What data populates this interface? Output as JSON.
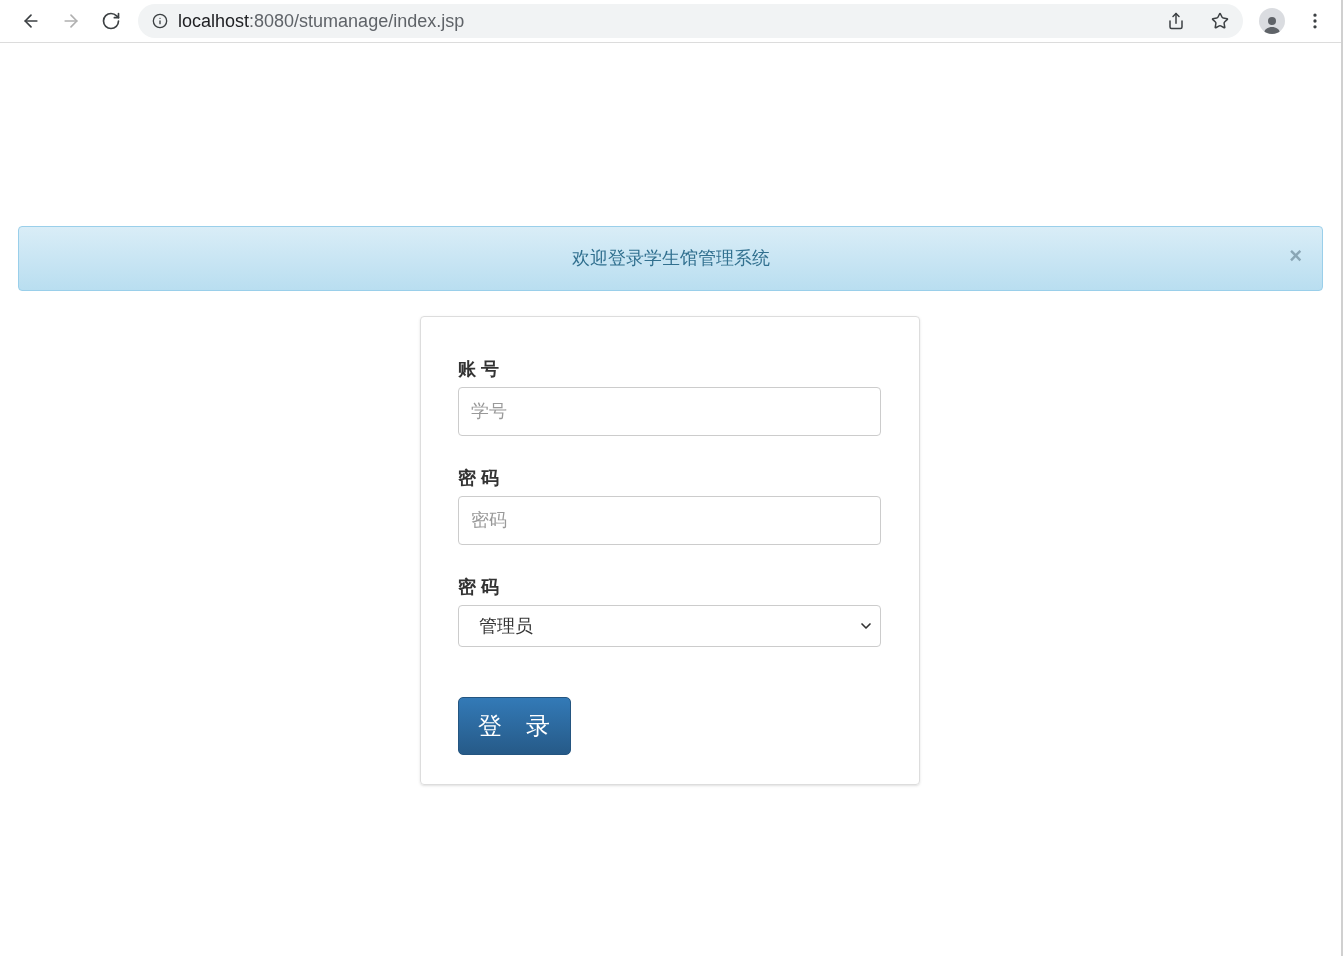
{
  "browser": {
    "nav": [
      {
        "kind": "back",
        "disabled": false
      },
      {
        "kind": "forward",
        "disabled": true
      },
      {
        "kind": "reload",
        "disabled": false
      }
    ],
    "url": {
      "host": "localhost",
      "path": ":8080/stumanage/index.jsp"
    }
  },
  "alert": {
    "message": "欢迎登录学生馆管理系统",
    "close": "×"
  },
  "form": {
    "fields": [
      {
        "kind": "input",
        "label": "账 号",
        "placeholder": "学号"
      },
      {
        "kind": "input",
        "label": "密 码",
        "placeholder": "密码"
      },
      {
        "kind": "select",
        "label": "密 码",
        "value": "管理员"
      }
    ],
    "submit": "登　录"
  }
}
